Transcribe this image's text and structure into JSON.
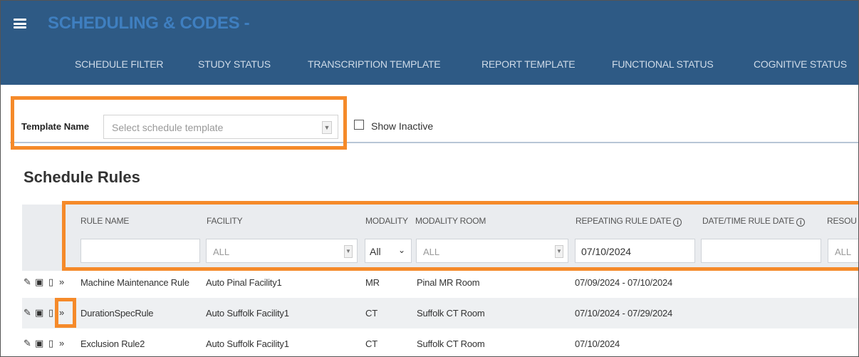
{
  "header": {
    "title": "SCHEDULING & CODES -",
    "nav": [
      "SCHEDULE FILTER",
      "STUDY STATUS",
      "TRANSCRIPTION TEMPLATE",
      "REPORT TEMPLATE",
      "FUNCTIONAL STATUS",
      "COGNITIVE STATUS"
    ]
  },
  "template_filter": {
    "label": "Template Name",
    "placeholder": "Select schedule template",
    "show_inactive_label": "Show Inactive",
    "show_inactive_checked": false
  },
  "section": {
    "title": "Schedule Rules"
  },
  "table": {
    "columns": [
      "RULE NAME",
      "FACILITY",
      "MODALITY",
      "MODALITY ROOM",
      "REPEATING RULE DATE",
      "DATE/TIME RULE DATE",
      "RESOU"
    ],
    "filters": {
      "rule_name": "",
      "facility": "ALL",
      "modality": "All",
      "modality_room": "ALL",
      "repeating_rule_date": "07/10/2024",
      "date_time_rule_date": "",
      "resource": "ALL"
    },
    "rows": [
      {
        "rule_name": "Machine Maintenance Rule",
        "facility": "Auto Pinal Facility1",
        "modality": "MR",
        "modality_room": "Pinal MR Room",
        "repeating_rule_date": "07/09/2024 - 07/10/2024"
      },
      {
        "rule_name": "DurationSpecRule",
        "facility": "Auto Suffolk Facility1",
        "modality": "CT",
        "modality_room": "Suffolk CT Room",
        "repeating_rule_date": "07/10/2024 - 07/29/2024"
      },
      {
        "rule_name": "Exclusion Rule2",
        "facility": "Auto Suffolk Facility1",
        "modality": "CT",
        "modality_room": "Suffolk CT Room",
        "repeating_rule_date": "07/10/2024"
      }
    ],
    "row_action_icons": [
      "edit-icon",
      "copy-icon",
      "delete-icon",
      "forward-icon"
    ]
  },
  "colors": {
    "header_bg": "#2e5a85",
    "title": "#3f7fc0",
    "highlight": "#f58a2a"
  }
}
